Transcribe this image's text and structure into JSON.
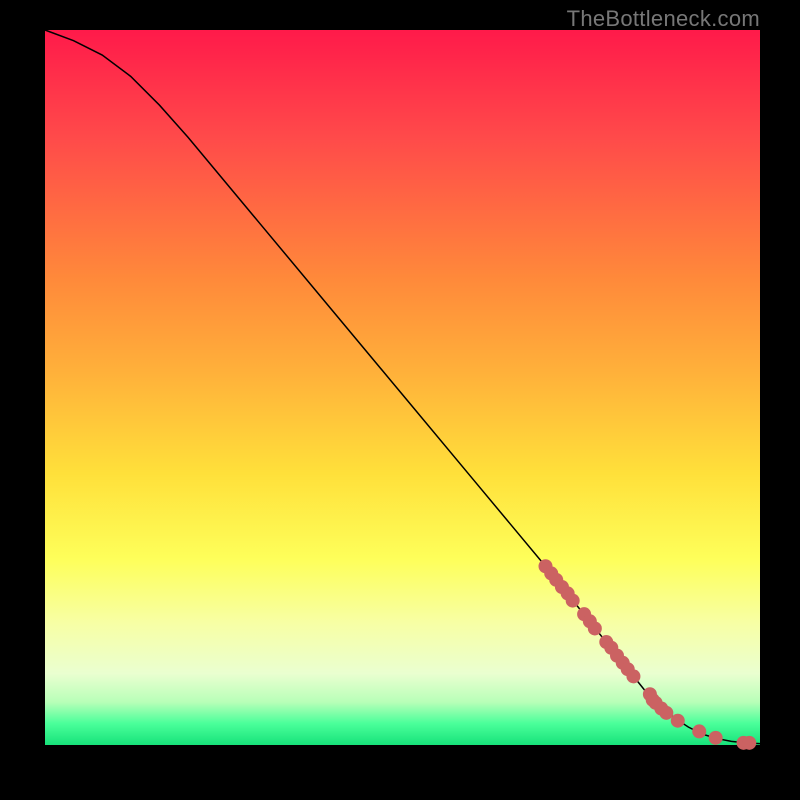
{
  "watermark": "TheBottleneck.com",
  "colors": {
    "background": "#000000",
    "marker": "#cb6262",
    "curve": "#000000"
  },
  "chart_data": {
    "type": "line",
    "title": "",
    "xlabel": "",
    "ylabel": "",
    "xlim": [
      0,
      100
    ],
    "ylim": [
      0,
      100
    ],
    "grid": false,
    "legend": false,
    "series": [
      {
        "name": "curve",
        "x": [
          0,
          4,
          8,
          12,
          16,
          20,
          30,
          40,
          50,
          60,
          70,
          76,
          80,
          84,
          86,
          88,
          90,
          92,
          94,
          96,
          98,
          100
        ],
        "y": [
          100,
          98.5,
          96.5,
          93.5,
          89.5,
          85,
          73,
          61,
          49,
          37,
          25,
          17.5,
          12.5,
          7.5,
          5.5,
          3.8,
          2.5,
          1.5,
          0.9,
          0.5,
          0.3,
          0.2
        ]
      }
    ],
    "markers": {
      "name": "highlighted-points",
      "x": [
        70.0,
        70.8,
        71.5,
        72.3,
        73.1,
        73.8,
        75.4,
        76.2,
        76.9,
        78.5,
        79.2,
        80.0,
        80.8,
        81.5,
        82.3,
        84.6,
        85.0,
        85.4,
        86.2,
        86.9,
        88.5,
        91.5,
        93.8,
        97.7,
        98.5
      ],
      "y": [
        25.0,
        24.0,
        23.1,
        22.1,
        21.2,
        20.2,
        18.3,
        17.3,
        16.3,
        14.4,
        13.6,
        12.5,
        11.5,
        10.6,
        9.6,
        7.1,
        6.3,
        5.9,
        5.1,
        4.5,
        3.4,
        1.9,
        1.0,
        0.3,
        0.3
      ]
    }
  }
}
